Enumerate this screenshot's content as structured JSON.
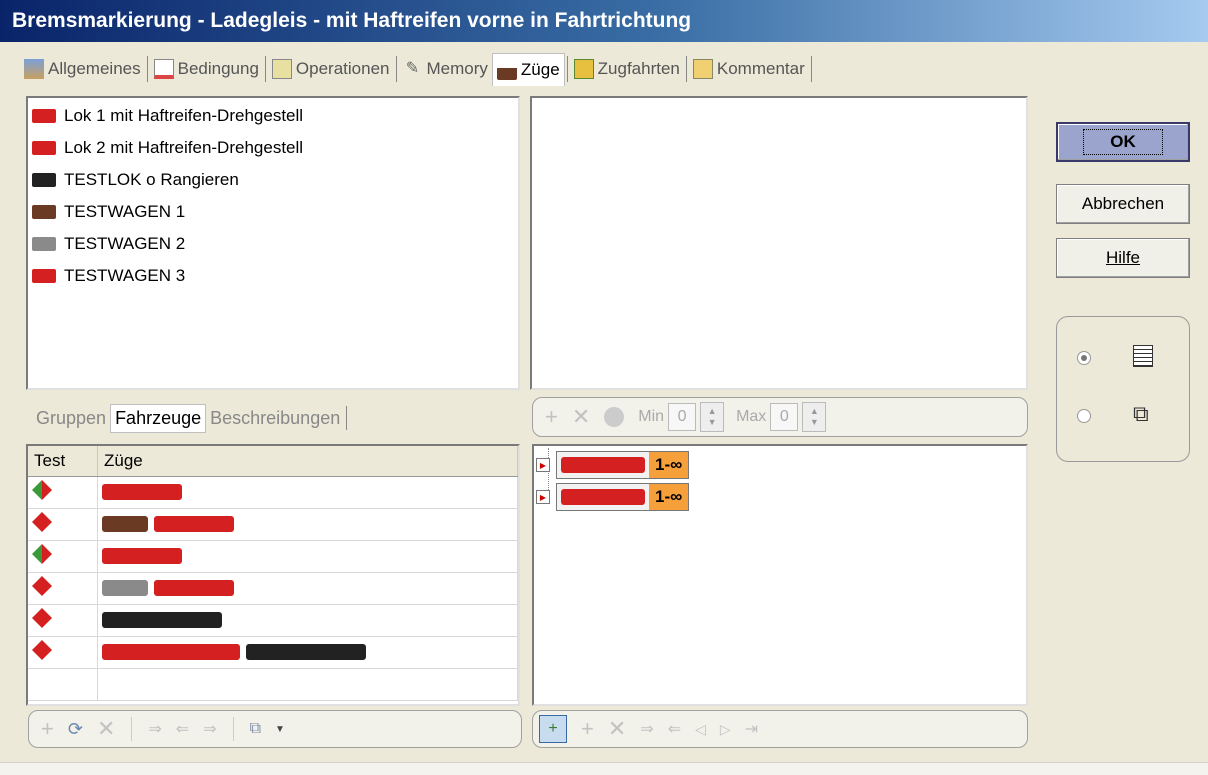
{
  "window": {
    "title": "Bremsmarkierung - Ladegleis - mit Haftreifen vorne in Fahrtrichtung"
  },
  "tabs": [
    {
      "label": "Allgemeines",
      "icon": "general-icon",
      "active": false
    },
    {
      "label": "Bedingung",
      "icon": "condition-icon",
      "active": false
    },
    {
      "label": "Operationen",
      "icon": "operations-icon",
      "active": false
    },
    {
      "label": "Memory",
      "icon": "memory-icon",
      "active": false
    },
    {
      "label": "Züge",
      "icon": "trains-icon",
      "active": true
    },
    {
      "label": "Zugfahrten",
      "icon": "train-routes-icon",
      "active": false
    },
    {
      "label": "Kommentar",
      "icon": "comment-icon",
      "active": false
    }
  ],
  "vehicles": [
    {
      "label": "Lok 1 mit Haftreifen-Drehgestell",
      "color": "#d42020"
    },
    {
      "label": "Lok 2 mit Haftreifen-Drehgestell",
      "color": "#d42020"
    },
    {
      "label": "TESTLOK o Rangieren",
      "color": "#222222"
    },
    {
      "label": "TESTWAGEN 1",
      "color": "#6b3a22"
    },
    {
      "label": "TESTWAGEN 2",
      "color": "#8a8a8a"
    },
    {
      "label": "TESTWAGEN 3",
      "color": "#d42020"
    }
  ],
  "subtabs": [
    "Gruppen",
    "Fahrzeuge",
    "Beschreibungen"
  ],
  "rule_toolbar": {
    "min_label": "Min",
    "min_value": "0",
    "max_label": "Max",
    "max_value": "0"
  },
  "trains_table": {
    "columns": [
      "Test",
      "Züge"
    ],
    "rows": [
      {
        "test": "green",
        "consist": [
          "#d42020"
        ]
      },
      {
        "test": "red",
        "consist": [
          "#6b3a22",
          "#d42020"
        ]
      },
      {
        "test": "green",
        "consist": [
          "#d42020"
        ]
      },
      {
        "test": "red",
        "consist": [
          "#8a8a8a",
          "#d42020"
        ]
      },
      {
        "test": "red",
        "consist": [
          "#222222"
        ]
      },
      {
        "test": "red",
        "consist": [
          "#d42020",
          "#222222"
        ]
      }
    ]
  },
  "rules": [
    {
      "count": "1-∞",
      "color": "#d42020"
    },
    {
      "count": "1-∞",
      "color": "#d42020"
    }
  ],
  "buttons": {
    "ok": "OK",
    "cancel": "Abbrechen",
    "help": "Hilfe"
  },
  "colors": {
    "selected_rule_count": "#f5a03a",
    "ok_button": "#9aa4cc"
  }
}
